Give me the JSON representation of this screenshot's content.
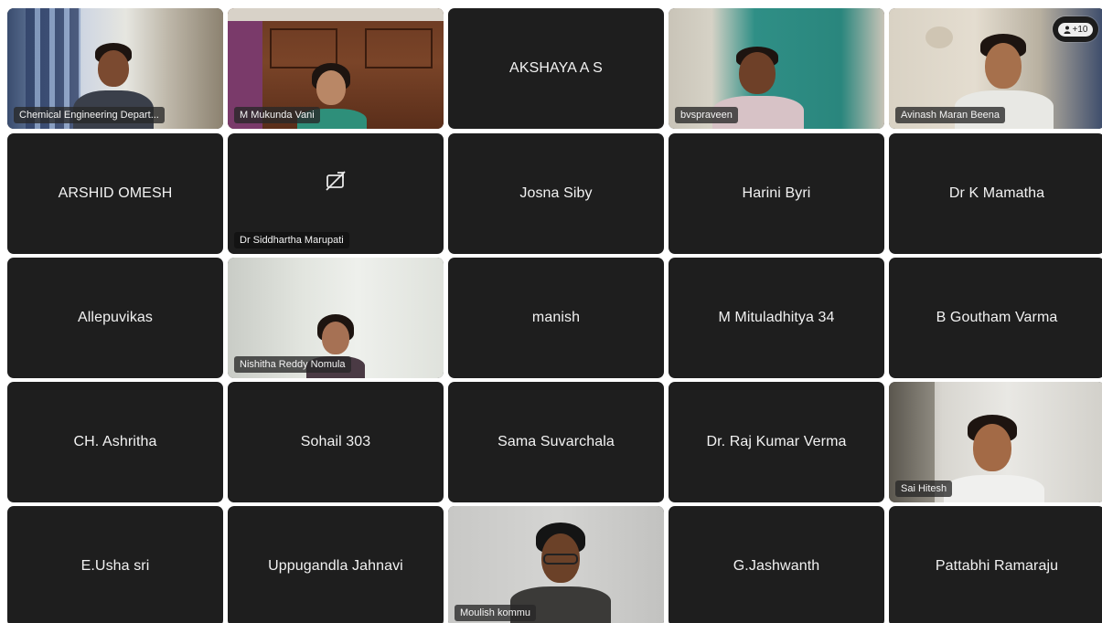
{
  "participants": [
    {
      "name": "Chemical Engineering Depart...",
      "video": true
    },
    {
      "name": "M Mukunda Vani",
      "video": true
    },
    {
      "name": "AKSHAYA A S",
      "video": false
    },
    {
      "name": "bvspraveen",
      "video": true
    },
    {
      "name": "Avinash Maran Beena",
      "video": true
    },
    {
      "name": "ARSHID OMESH",
      "video": false
    },
    {
      "name": "Dr Siddhartha Marupati",
      "video": false,
      "camera_off_icon": true
    },
    {
      "name": "Josna Siby",
      "video": false
    },
    {
      "name": "Harini Byri",
      "video": false
    },
    {
      "name": "Dr K Mamatha",
      "video": false
    },
    {
      "name": "Allepuvikas",
      "video": false
    },
    {
      "name": "Nishitha Reddy Nomula",
      "video": true
    },
    {
      "name": "manish",
      "video": false
    },
    {
      "name": "M Mituladhitya 34",
      "video": false
    },
    {
      "name": "B Goutham Varma",
      "video": false
    },
    {
      "name": "CH. Ashritha",
      "video": false
    },
    {
      "name": "Sohail 303",
      "video": false
    },
    {
      "name": "Sama Suvarchala",
      "video": false
    },
    {
      "name": "Dr. Raj Kumar Verma",
      "video": false
    },
    {
      "name": "Sai Hitesh",
      "video": true
    },
    {
      "name": "E.Usha sri",
      "video": false
    },
    {
      "name": "Uppugandla Jahnavi",
      "video": false
    },
    {
      "name": "Moulish kommu",
      "video": true
    },
    {
      "name": "G.Jashwanth",
      "video": false
    },
    {
      "name": "Pattabhi Ramaraju",
      "video": false
    }
  ],
  "overflow": {
    "label": "+10",
    "icon": "person-icon"
  },
  "colors": {
    "tile_bg": "#1e1e1e",
    "page_bg": "#ffffff",
    "text": "#f2f2f2"
  }
}
